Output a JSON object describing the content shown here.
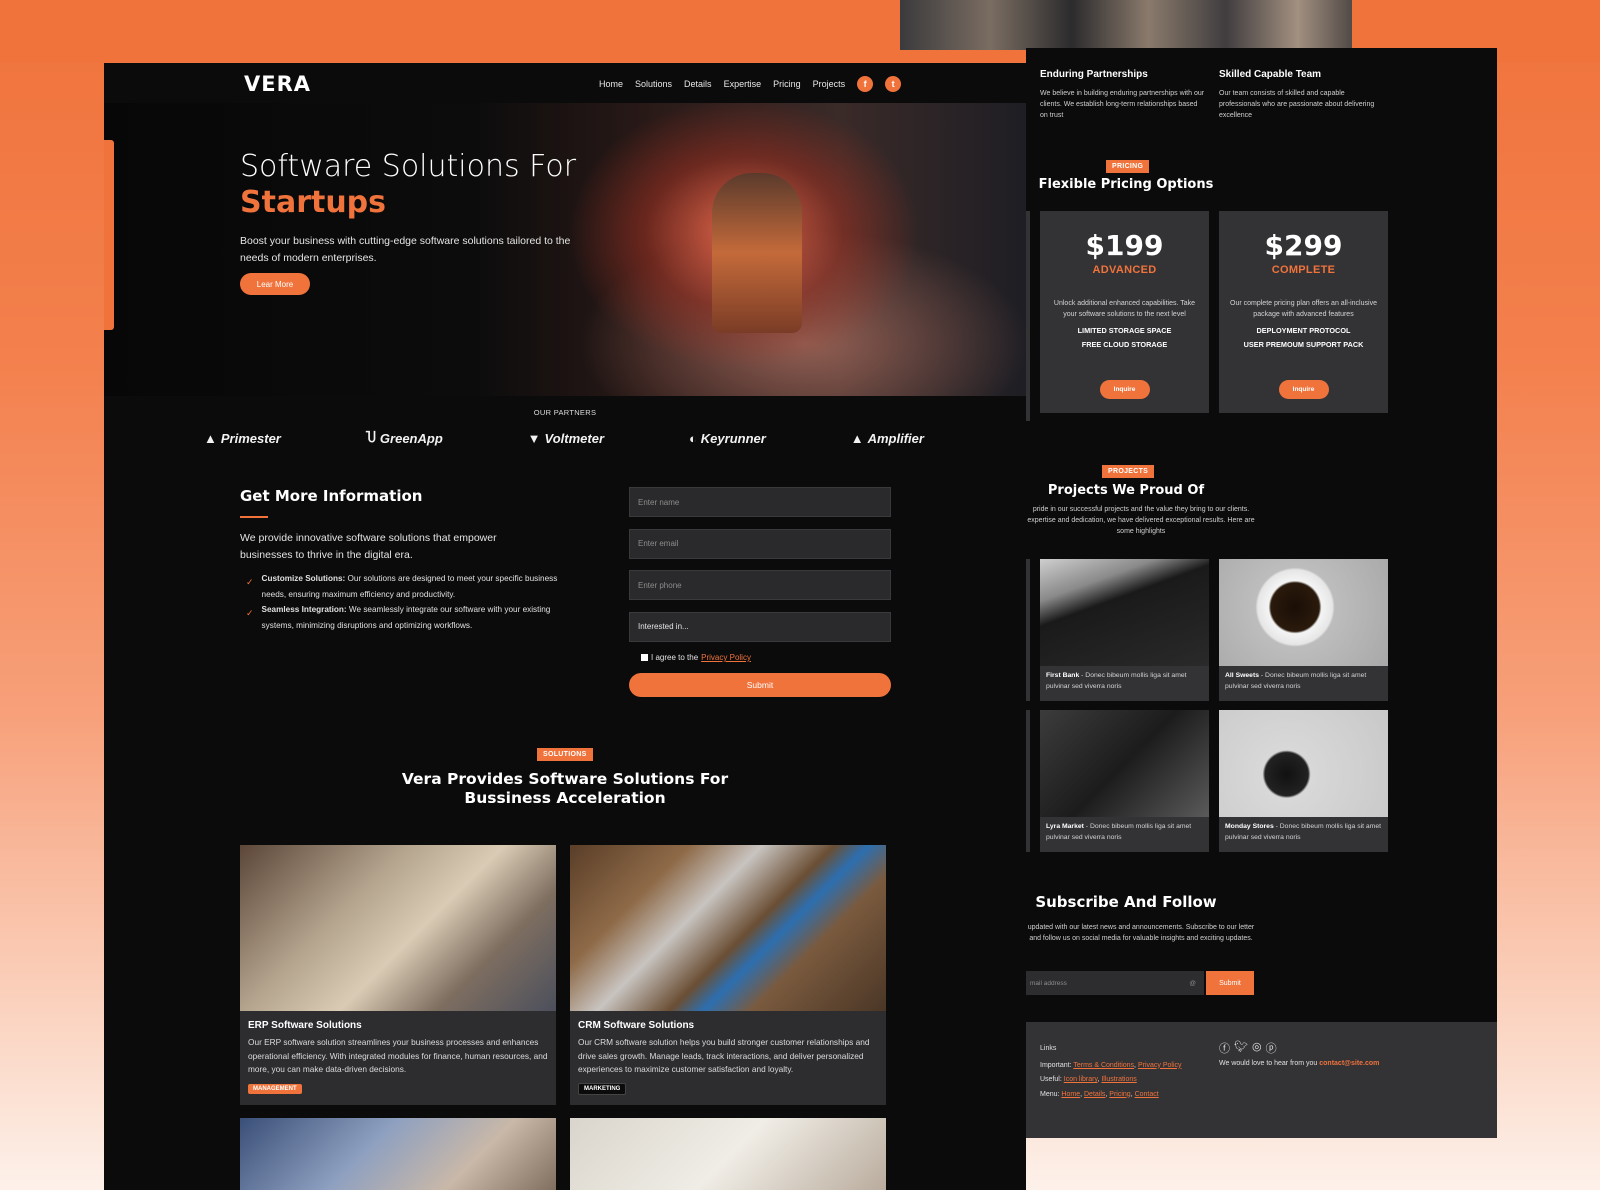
{
  "brand": {
    "logo": "VERA",
    "accent": "#f0733c"
  },
  "nav": {
    "items": [
      "Home",
      "Solutions",
      "Details",
      "Expertise",
      "Pricing",
      "Projects"
    ],
    "social": [
      "f",
      "t"
    ]
  },
  "hero": {
    "title": "Software Solutions For",
    "title_accent": "Startups",
    "subtitle": "Boost your business with cutting-edge software solutions tailored to the needs of modern enterprises.",
    "button": "Lear More"
  },
  "partners": {
    "title": "OUR PARTNERS",
    "items": [
      {
        "icon": "▲",
        "name": "Primester"
      },
      {
        "icon": "Ⴎ",
        "name": "GreenApp"
      },
      {
        "icon": "▼",
        "name": "Voltmeter"
      },
      {
        "icon": "◐",
        "name": "Keyrunner"
      },
      {
        "icon": "▲",
        "name": "Amplifier"
      }
    ]
  },
  "info": {
    "title": "Get More Information",
    "text": "We provide innovative software solutions that empower businesses to thrive in the digital era.",
    "checks": [
      {
        "bold": "Customize Solutions:",
        "text": " Our solutions are designed to meet your specific business needs, ensuring maximum efficiency and productivity."
      },
      {
        "bold": "Seamless Integration:",
        "text": " We seamlessly integrate our software with your existing systems, minimizing disruptions and optimizing workflows."
      }
    ],
    "form": {
      "name_placeholder": "Enter name",
      "email_placeholder": "Enter email",
      "phone_placeholder": "Enter phone",
      "select_value": "Interested in...",
      "agree": "I agree to the",
      "privacy": "Privacy Policy",
      "submit": "Submit"
    }
  },
  "solutions": {
    "tag": "SOLUTIONS",
    "title": "Vera Provides Software Solutions For Bussiness Acceleration",
    "cards": [
      {
        "title": "ERP Software Solutions",
        "text": "Our ERP software solution streamlines your business processes and enhances operational efficiency. With integrated modules for finance, human resources, and more, you can make data-driven decisions.",
        "badge": "MANAGEMENT"
      },
      {
        "title": "CRM Software Solutions",
        "text": "Our CRM software solution helps you build stronger customer relationships and drive sales growth. Manage leads, track interactions, and deliver personalized experiences to maximize customer satisfaction and loyalty.",
        "badge": "MARKETING"
      }
    ]
  },
  "features": [
    {
      "title": "Enduring Partnerships",
      "text": "We believe in building enduring partnerships with our clients. We establish long-term relationships based on trust"
    },
    {
      "title": "Skilled Capable Team",
      "text": "Our team consists of skilled and capable professionals who are passionate about delivering excellence"
    }
  ],
  "pricing": {
    "tag": "PRICING",
    "title": "Flexible Pricing Options",
    "plans": [
      {
        "price": "$199",
        "name": "ADVANCED",
        "desc": "Unlock additional enhanced capabilities. Take your software solutions to the next level",
        "lines": [
          "LIMITED STORAGE SPACE",
          "FREE CLOUD STORAGE"
        ],
        "button": "Inquire"
      },
      {
        "price": "$299",
        "name": "COMPLETE",
        "desc": "Our complete pricing plan offers an all-inclusive package with advanced features",
        "lines": [
          "DEPLOYMENT PROTOCOL",
          "USER PREMOUM SUPPORT PACK"
        ],
        "button": "Inquire"
      }
    ]
  },
  "projects": {
    "tag": "PROJECTS",
    "title": "Projects We Proud Of",
    "subtitle": "pride in our successful projects and the value they bring to our clients. expertise and dedication, we have delivered exceptional results. Here are some highlights",
    "items": [
      {
        "name": "First Bank",
        "text": " - Donec bibeum mollis liga sit amet pulvinar sed viverra noris"
      },
      {
        "name": "All Sweets",
        "text": " - Donec bibeum mollis liga sit amet pulvinar sed viverra noris"
      },
      {
        "name": "Lyra Market",
        "text": " - Donec bibeum mollis liga sit amet pulvinar sed viverra noris"
      },
      {
        "name": "Monday Stores",
        "text": " - Donec bibeum mollis liga sit amet pulvinar sed viverra noris"
      }
    ]
  },
  "subscribe": {
    "title": "Subscribe And Follow",
    "text": "updated with our latest news and announcements. Subscribe to our letter and follow us on social media for valuable insights and exciting updates.",
    "placeholder": "mail address",
    "button": "Submit"
  },
  "footer": {
    "links_title": "Links",
    "important_label": "Important:",
    "important": [
      "Terms & Conditions",
      "Privacy Policy"
    ],
    "useful_label": "Useful:",
    "useful": [
      "Icon library",
      "Illustrations"
    ],
    "menu_label": "Menu:",
    "menu": [
      "Home",
      "Details",
      "Pricing",
      "Contact"
    ],
    "social": [
      "facebook-icon",
      "twitter-icon",
      "instagram-icon",
      "pinterest-icon"
    ],
    "contact_text": "We would love to hear from you",
    "contact_email": "contact@site.com"
  }
}
